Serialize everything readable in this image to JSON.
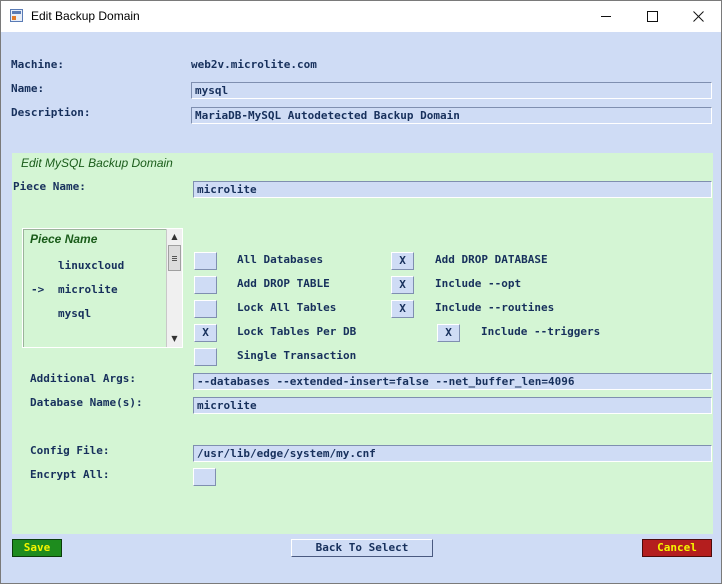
{
  "window": {
    "title": "Edit Backup Domain"
  },
  "labels": {
    "machine": "Machine:",
    "name": "Name:",
    "description": "Description:",
    "piece_name": "Piece Name:",
    "additional_args": "Additional Args:",
    "database_names": "Database Name(s):",
    "config_file": "Config File:",
    "encrypt_all": "Encrypt All:"
  },
  "values": {
    "machine": "web2v.microlite.com",
    "name": "mysql",
    "description": "MariaDB-MySQL Autodetected Backup Domain",
    "piece_name": "microlite",
    "additional_args": "--databases --extended-insert=false --net_buffer_len=4096",
    "database_names": "microlite",
    "config_file": "/usr/lib/edge/system/my.cnf"
  },
  "panel": {
    "title": "Edit MySQL Backup Domain"
  },
  "piece_list": {
    "title": "Piece Name",
    "selected_marker": "->",
    "items": [
      "linuxcloud",
      "microlite",
      "mysql"
    ]
  },
  "options": {
    "all_databases": {
      "label": "All Databases",
      "mark": ""
    },
    "add_drop_table": {
      "label": "Add DROP TABLE",
      "mark": ""
    },
    "lock_all_tables": {
      "label": "Lock All Tables",
      "mark": ""
    },
    "lock_tables_per_db": {
      "label": "Lock Tables Per DB",
      "mark": "X"
    },
    "single_transaction": {
      "label": "Single Transaction",
      "mark": ""
    },
    "add_drop_database": {
      "label": "Add DROP DATABASE",
      "mark": "X"
    },
    "include_opt": {
      "label": "Include --opt",
      "mark": "X"
    },
    "include_routines": {
      "label": "Include --routines",
      "mark": "X"
    },
    "include_triggers": {
      "label": "Include --triggers",
      "mark": "X"
    },
    "encrypt_all": {
      "mark": ""
    }
  },
  "buttons": {
    "save": "Save",
    "back": "Back To Select",
    "cancel": "Cancel"
  },
  "colors": {
    "save_bg": "#1e8c1e",
    "save_fg": "#f5f500",
    "cancel_bg": "#b41e1e",
    "cancel_fg": "#f5f500"
  }
}
